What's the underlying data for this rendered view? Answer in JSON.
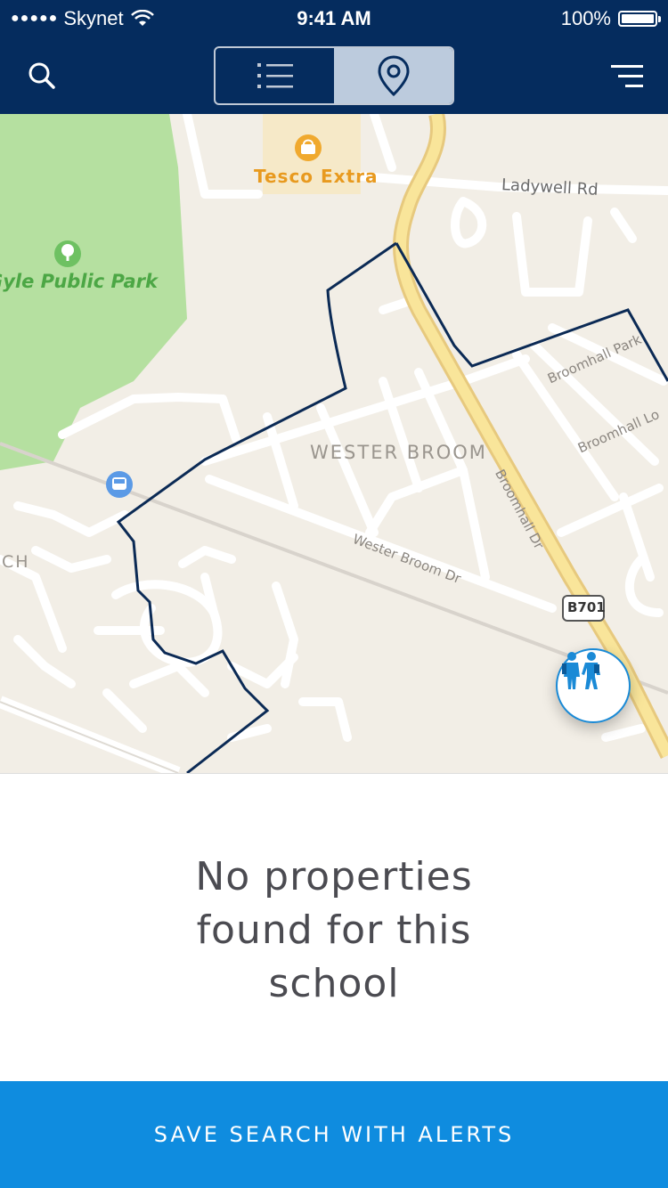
{
  "status_bar": {
    "signal": "●●●●●",
    "carrier": "Skynet",
    "time": "9:41 AM",
    "battery": "100%"
  },
  "nav": {
    "search_icon": "search-icon",
    "segments": [
      {
        "icon": "list-icon",
        "selected": false
      },
      {
        "icon": "map-pin-icon",
        "selected": true
      }
    ],
    "menu_icon": "filter-menu-icon"
  },
  "map": {
    "labels": {
      "tesco": "Tesco Extra",
      "park": "Gyle Public Park",
      "ladywell": "Ladywell Rd",
      "wester_broom": "WESTER BROOM",
      "broomhall_park": "Broomhall Park",
      "broomhall_loan": "Broomhall Lo",
      "wester_broom_dr": "Wester Broom Dr",
      "broomhall_dr": "Broomhall Dr",
      "road_number": "B701",
      "ch": "CH"
    },
    "boundary_color": "#0b2a55",
    "school_button_icon": "school-children-icon"
  },
  "empty_state": {
    "message": "No properties found for this school"
  },
  "cta": {
    "label": "SAVE SEARCH WITH ALERTS",
    "color": "#0f8cdf"
  }
}
